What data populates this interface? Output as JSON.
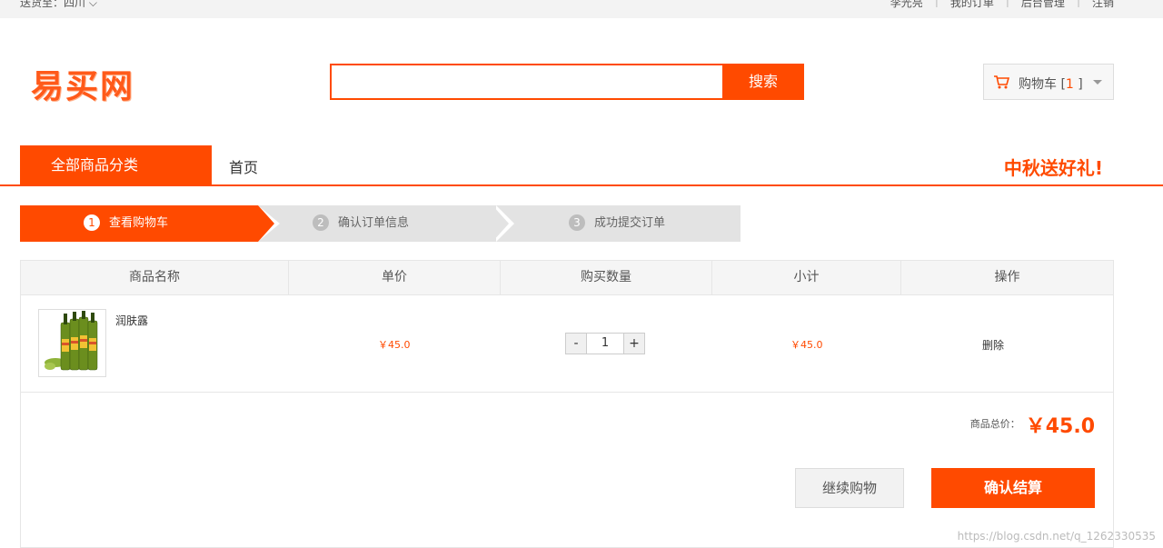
{
  "topbar": {
    "location": "送货至：四川 ⌵",
    "links": [
      "李光亮",
      "我的订单",
      "后台管理",
      "注销"
    ]
  },
  "logo": {
    "text": "易买网"
  },
  "search": {
    "value": "",
    "button": "搜索"
  },
  "cart": {
    "label": "购物车 [",
    "count": "1",
    "close": "]"
  },
  "nav": {
    "all_categories": "全部商品分类",
    "home": "首页",
    "promo": "中秋送好礼!"
  },
  "steps": [
    {
      "num": "1",
      "label": "查看购物车"
    },
    {
      "num": "2",
      "label": "确认订单信息"
    },
    {
      "num": "3",
      "label": "成功提交订单"
    }
  ],
  "table": {
    "headers": [
      "商品名称",
      "单价",
      "购买数量",
      "小计",
      "操作"
    ],
    "rows": [
      {
        "name": "润肤露",
        "price": "￥45.0",
        "qty": "1",
        "subtotal": "￥45.0",
        "action": "删除",
        "minus": "-",
        "plus": "+"
      }
    ]
  },
  "summary": {
    "total_label": "商品总价：",
    "total": "￥45.0"
  },
  "buttons": {
    "continue": "继续购物",
    "checkout": "确认结算"
  },
  "watermark": "https://blog.csdn.net/q_1262330535",
  "colors": {
    "accent": "#ff4a00"
  }
}
